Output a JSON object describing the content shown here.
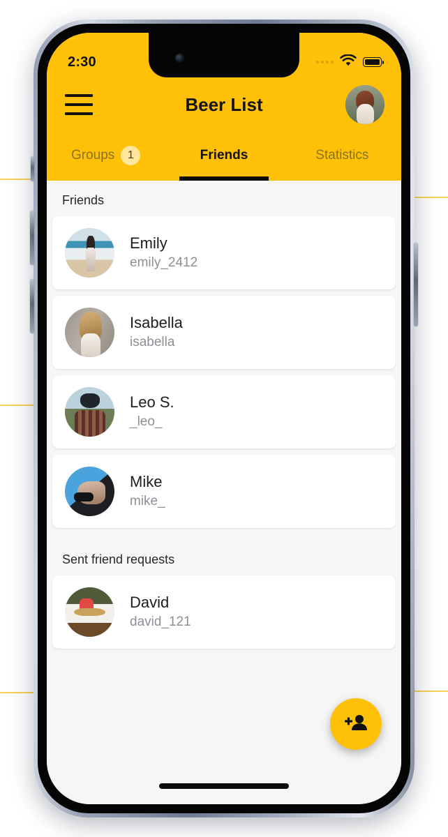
{
  "status_bar": {
    "time": "2:30",
    "signal_icon": "signal-dots-icon",
    "wifi_icon": "wifi-icon",
    "battery_icon": "battery-full-icon"
  },
  "app_bar": {
    "menu_icon": "hamburger-menu-icon",
    "title": "Beer List",
    "avatar_icon": "profile-avatar"
  },
  "tabs": [
    {
      "label": "Groups",
      "badge": "1",
      "active": false
    },
    {
      "label": "Friends",
      "badge": null,
      "active": true
    },
    {
      "label": "Statistics",
      "badge": null,
      "active": false
    }
  ],
  "sections": [
    {
      "header": "Friends",
      "items": [
        {
          "name": "Emily",
          "handle": "emily_2412",
          "avatar": "ph-emily"
        },
        {
          "name": "Isabella",
          "handle": "isabella",
          "avatar": "ph-isabella"
        },
        {
          "name": "Leo S.",
          "handle": "_leo_",
          "avatar": "ph-leo"
        },
        {
          "name": "Mike",
          "handle": "mike_",
          "avatar": "ph-mike"
        }
      ]
    },
    {
      "header": "Sent friend requests",
      "items": [
        {
          "name": "David",
          "handle": "david_121",
          "avatar": "ph-david"
        }
      ]
    }
  ],
  "fab": {
    "icon": "person-add-icon",
    "label": "Add friend"
  },
  "colors": {
    "accent": "#FFC107",
    "badge_bg": "#FFE69B",
    "content_bg": "#F6F6F6",
    "card_bg": "#FFFFFF",
    "primary_text": "#1B1D20",
    "secondary_text": "#8C9095",
    "inactive_tab_text": "#8A7220"
  }
}
